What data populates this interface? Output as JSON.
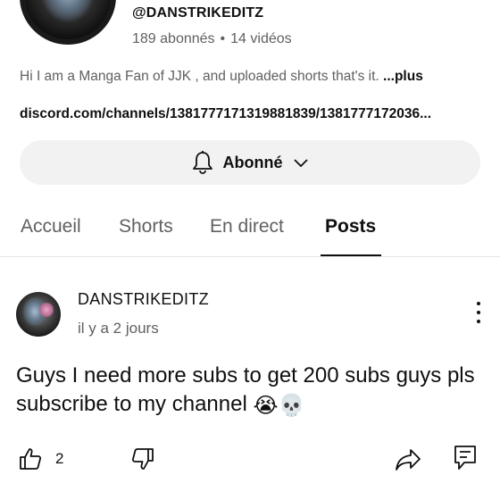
{
  "channel": {
    "handle": "@DANSTRIKEDITZ",
    "subscribers": "189 abonnés",
    "separator": "•",
    "videos": "14 vidéos",
    "description": "Hi I am a Manga Fan of JJK , and uploaded shorts that's it. ",
    "more_label": "...plus",
    "link": "discord.com/channels/1381777171319881839/1381777172036..."
  },
  "subscribe_button": {
    "label": "Abonné",
    "icon": "bell-icon",
    "dropdown_icon": "chevron-down-icon"
  },
  "tabs": [
    {
      "label": "Accueil",
      "active": false
    },
    {
      "label": "Shorts",
      "active": false
    },
    {
      "label": "En direct",
      "active": false
    },
    {
      "label": "Posts",
      "active": true
    }
  ],
  "post": {
    "author": "DANSTRIKEDITZ",
    "time": "il y a 2 jours",
    "text": "Guys I need more subs to get 200 subs guys pls subscribe to my channel ",
    "emojis": [
      "😭",
      "💀"
    ],
    "likes": "2",
    "menu_icon": "more-vertical-icon"
  },
  "actions": {
    "like_icon": "thumbs-up-icon",
    "dislike_icon": "thumbs-down-icon",
    "share_icon": "share-icon",
    "comment_icon": "comment-icon"
  },
  "colors": {
    "text_primary": "#0f0f0f",
    "text_secondary": "#606060",
    "button_bg": "#f2f2f2",
    "divider": "#e5e5e5"
  }
}
